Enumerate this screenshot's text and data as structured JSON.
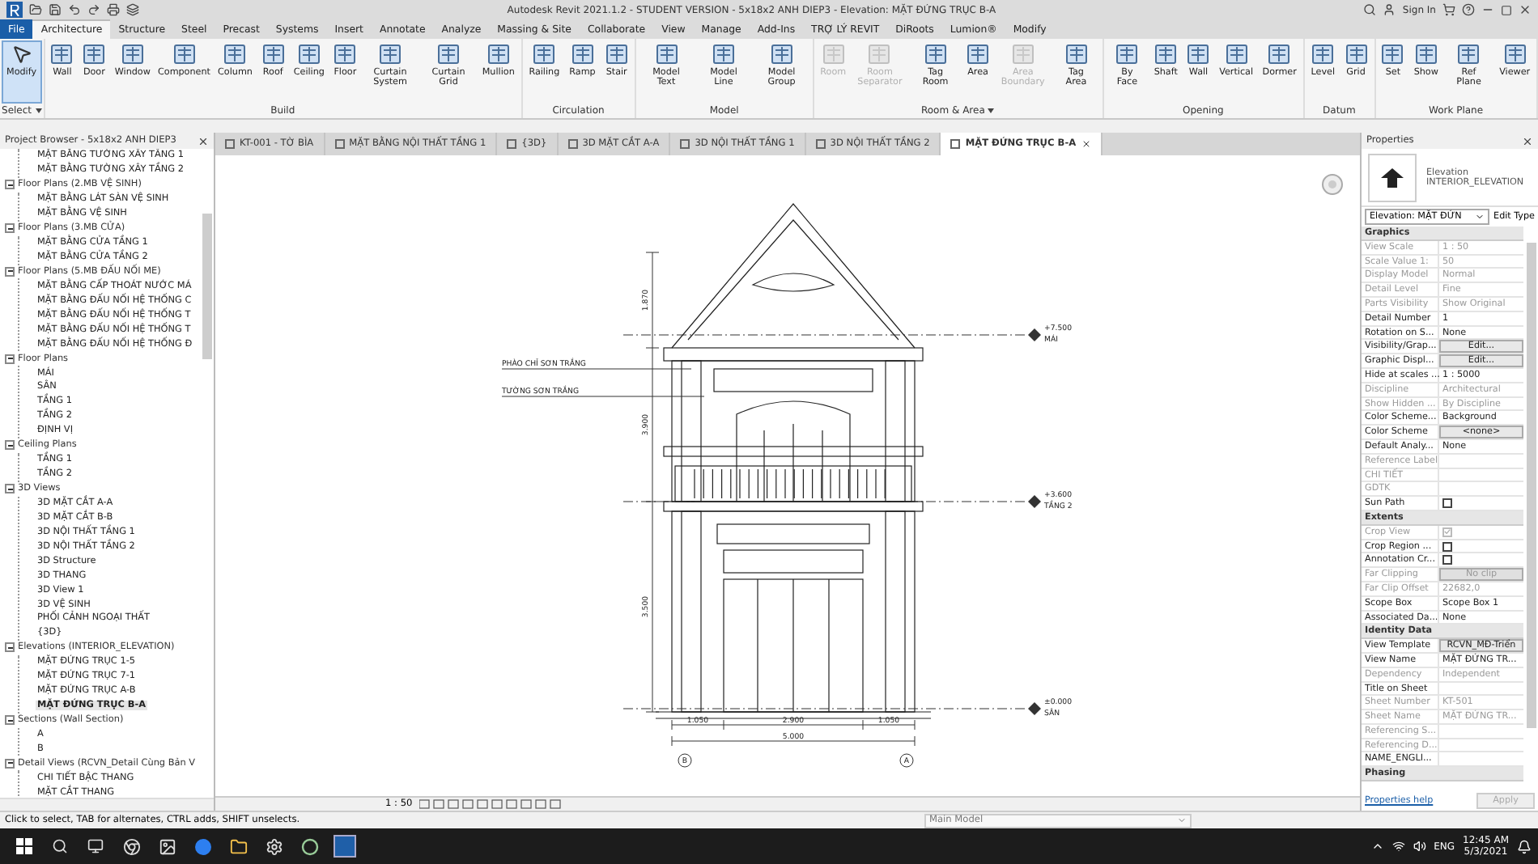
{
  "window": {
    "title": "Autodesk Revit 2021.1.2 - STUDENT VERSION - 5x18x2 ANH DIEP3 - Elevation: MẶT ĐỨNG TRỤC B-A",
    "sign_in": "Sign In"
  },
  "ribbon_tabs": [
    {
      "label": "File",
      "selected": false,
      "kind": "file"
    },
    {
      "label": "Architecture",
      "selected": true,
      "kind": "tab"
    },
    {
      "label": "Structure",
      "selected": false,
      "kind": "tab"
    },
    {
      "label": "Steel",
      "selected": false,
      "kind": "tab"
    },
    {
      "label": "Precast",
      "selected": false,
      "kind": "tab"
    },
    {
      "label": "Systems",
      "selected": false,
      "kind": "tab"
    },
    {
      "label": "Insert",
      "selected": false,
      "kind": "tab"
    },
    {
      "label": "Annotate",
      "selected": false,
      "kind": "tab"
    },
    {
      "label": "Analyze",
      "selected": false,
      "kind": "tab"
    },
    {
      "label": "Massing & Site",
      "selected": false,
      "kind": "tab"
    },
    {
      "label": "Collaborate",
      "selected": false,
      "kind": "tab"
    },
    {
      "label": "View",
      "selected": false,
      "kind": "tab"
    },
    {
      "label": "Manage",
      "selected": false,
      "kind": "tab"
    },
    {
      "label": "Add-Ins",
      "selected": false,
      "kind": "tab"
    },
    {
      "label": "TRỢ LÝ REVIT",
      "selected": false,
      "kind": "tab"
    },
    {
      "label": "DiRoots",
      "selected": false,
      "kind": "tab"
    },
    {
      "label": "Lumion®",
      "selected": false,
      "kind": "tab"
    },
    {
      "label": "Modify",
      "selected": false,
      "kind": "tab"
    }
  ],
  "ribbon_groups": [
    {
      "label": "Select",
      "dropdown": true,
      "tools": [
        {
          "label": "Modify",
          "selected": true,
          "disabled": false
        }
      ]
    },
    {
      "label": "Build",
      "dropdown": false,
      "tools": [
        {
          "label": "Wall",
          "selected": false,
          "disabled": false
        },
        {
          "label": "Door",
          "selected": false,
          "disabled": false
        },
        {
          "label": "Window",
          "selected": false,
          "disabled": false
        },
        {
          "label": "Component",
          "selected": false,
          "disabled": false
        },
        {
          "label": "Column",
          "selected": false,
          "disabled": false
        },
        {
          "label": "Roof",
          "selected": false,
          "disabled": false
        },
        {
          "label": "Ceiling",
          "selected": false,
          "disabled": false
        },
        {
          "label": "Floor",
          "selected": false,
          "disabled": false
        },
        {
          "label": "Curtain System",
          "selected": false,
          "disabled": false
        },
        {
          "label": "Curtain Grid",
          "selected": false,
          "disabled": false
        },
        {
          "label": "Mullion",
          "selected": false,
          "disabled": false
        }
      ]
    },
    {
      "label": "Circulation",
      "dropdown": false,
      "tools": [
        {
          "label": "Railing",
          "selected": false,
          "disabled": false
        },
        {
          "label": "Ramp",
          "selected": false,
          "disabled": false
        },
        {
          "label": "Stair",
          "selected": false,
          "disabled": false
        }
      ]
    },
    {
      "label": "Model",
      "dropdown": false,
      "tools": [
        {
          "label": "Model Text",
          "selected": false,
          "disabled": false
        },
        {
          "label": "Model Line",
          "selected": false,
          "disabled": false
        },
        {
          "label": "Model Group",
          "selected": false,
          "disabled": false
        }
      ]
    },
    {
      "label": "Room & Area",
      "dropdown": true,
      "tools": [
        {
          "label": "Room",
          "selected": false,
          "disabled": true
        },
        {
          "label": "Room Separator",
          "selected": false,
          "disabled": true
        },
        {
          "label": "Tag Room",
          "selected": false,
          "disabled": false
        },
        {
          "label": "Area",
          "selected": false,
          "disabled": false
        },
        {
          "label": "Area Boundary",
          "selected": false,
          "disabled": true
        },
        {
          "label": "Tag Area",
          "selected": false,
          "disabled": false
        }
      ]
    },
    {
      "label": "Opening",
      "dropdown": false,
      "tools": [
        {
          "label": "By Face",
          "selected": false,
          "disabled": false
        },
        {
          "label": "Shaft",
          "selected": false,
          "disabled": false
        },
        {
          "label": "Wall",
          "selected": false,
          "disabled": false
        },
        {
          "label": "Vertical",
          "selected": false,
          "disabled": false
        },
        {
          "label": "Dormer",
          "selected": false,
          "disabled": false
        }
      ]
    },
    {
      "label": "Datum",
      "dropdown": false,
      "tools": [
        {
          "label": "Level",
          "selected": false,
          "disabled": false
        },
        {
          "label": "Grid",
          "selected": false,
          "disabled": false
        }
      ]
    },
    {
      "label": "Work Plane",
      "dropdown": false,
      "tools": [
        {
          "label": "Set",
          "selected": false,
          "disabled": false
        },
        {
          "label": "Show",
          "selected": false,
          "disabled": false
        },
        {
          "label": "Ref Plane",
          "selected": false,
          "disabled": false
        },
        {
          "label": "Viewer",
          "selected": false,
          "disabled": false
        }
      ]
    }
  ],
  "project_browser": {
    "title": "Project Browser - 5x18x2 ANH DIEP3",
    "top_items": [
      {
        "label": "MẶT BẰNG TƯỜNG XÂY TẦNG 1",
        "selected": false
      },
      {
        "label": "MẶT BẰNG TƯỜNG XÂY TẦNG 2",
        "selected": false
      }
    ],
    "tree": [
      {
        "label": "Floor Plans (2.MB VỆ SINH)",
        "expanded": true,
        "children": [
          {
            "label": "MẶT BẰNG LÁT SÀN VỆ SINH",
            "selected": false
          },
          {
            "label": "MẶT BẰNG VỆ SINH",
            "selected": false
          }
        ]
      },
      {
        "label": "Floor Plans (3.MB CỬA)",
        "expanded": true,
        "children": [
          {
            "label": "MẶT BẰNG CỬA TẦNG 1",
            "selected": false
          },
          {
            "label": "MẶT BẰNG CỬA TẦNG 2",
            "selected": false
          }
        ]
      },
      {
        "label": "Floor Plans (5.MB ĐẤU NỐI ME)",
        "expanded": true,
        "children": [
          {
            "label": "MẶT BẰNG CẤP THOÁT NƯỚC MÁ",
            "selected": false
          },
          {
            "label": "MẶT BẰNG ĐẤU NỐI HỆ THỐNG C",
            "selected": false
          },
          {
            "label": "MẶT BẰNG ĐẤU NỐI HỆ THỐNG T",
            "selected": false
          },
          {
            "label": "MẶT BẰNG ĐẤU NỐI HỆ THỐNG T",
            "selected": false
          },
          {
            "label": "MẶT BẰNG ĐẤU NỐI HỆ THỐNG Đ",
            "selected": false
          }
        ]
      },
      {
        "label": "Floor Plans",
        "expanded": true,
        "children": [
          {
            "label": "MÁI",
            "selected": false
          },
          {
            "label": "SÂN",
            "selected": false
          },
          {
            "label": "TẦNG 1",
            "selected": false
          },
          {
            "label": "TẦNG 2",
            "selected": false
          },
          {
            "label": "ĐỊNH VỊ",
            "selected": false
          }
        ]
      },
      {
        "label": "Ceiling Plans",
        "expanded": true,
        "children": [
          {
            "label": "TẦNG 1",
            "selected": false
          },
          {
            "label": "TẦNG 2",
            "selected": false
          }
        ]
      },
      {
        "label": "3D Views",
        "expanded": true,
        "children": [
          {
            "label": "3D MẶT CẮT A-A",
            "selected": false
          },
          {
            "label": "3D MẶT CẮT B-B",
            "selected": false
          },
          {
            "label": "3D NỘI THẤT TẦNG 1",
            "selected": false
          },
          {
            "label": "3D NỘI THẤT TẦNG 2",
            "selected": false
          },
          {
            "label": "3D Structure",
            "selected": false
          },
          {
            "label": "3D THANG",
            "selected": false
          },
          {
            "label": "3D View 1",
            "selected": false
          },
          {
            "label": "3D VỆ SINH",
            "selected": false
          },
          {
            "label": "PHỐI CẢNH NGOẠI THẤT",
            "selected": false
          },
          {
            "label": "{3D}",
            "selected": false
          }
        ]
      },
      {
        "label": "Elevations (INTERIOR_ELEVATION)",
        "expanded": true,
        "children": [
          {
            "label": "MẶT ĐỨNG TRỤC 1-5",
            "selected": false
          },
          {
            "label": "MẶT ĐỨNG TRỤC 7-1",
            "selected": false
          },
          {
            "label": "MẶT ĐỨNG TRỤC A-B",
            "selected": false
          },
          {
            "label": "MẶT ĐỨNG TRỤC B-A",
            "selected": true
          }
        ]
      },
      {
        "label": "Sections (Wall Section)",
        "expanded": true,
        "children": [
          {
            "label": "A",
            "selected": false
          },
          {
            "label": "B",
            "selected": false
          }
        ]
      },
      {
        "label": "Detail Views (RCVN_Detail Cùng Bản V",
        "expanded": true,
        "children": [
          {
            "label": "CHI TIẾT BẬC THANG",
            "selected": false
          },
          {
            "label": "MẶT CẮT THANG",
            "selected": false
          }
        ]
      }
    ]
  },
  "view_tabs": [
    {
      "label": "KT-001 - TỜ BÌA",
      "selected": false
    },
    {
      "label": "MẶT BẰNG NỘI THẤT TẦNG 1",
      "selected": false
    },
    {
      "label": "{3D}",
      "selected": false
    },
    {
      "label": "3D MẶT CẮT A-A",
      "selected": false
    },
    {
      "label": "3D NỘI THẤT TẦNG 1",
      "selected": false
    },
    {
      "label": "3D NỘI THẤT TẦNG 2",
      "selected": false
    },
    {
      "label": "MẶT ĐỨNG TRỤC B-A",
      "selected": true
    }
  ],
  "drawing": {
    "notes": [
      "PHÀO CHỈ SƠN TRẮNG",
      "TƯỜNG SƠN TRẮNG"
    ],
    "levels": [
      {
        "name": "MÁI",
        "elevation": "+7.500"
      },
      {
        "name": "TẦNG 2",
        "elevation": "+3.600"
      },
      {
        "name": "SÂN",
        "elevation": "±0.000"
      }
    ],
    "vertical_dims": [
      "1.870",
      "3.900",
      "3.500"
    ],
    "horizontal_dims": [
      "1.050",
      "2.900",
      "1.050"
    ],
    "total_dim": "5.000",
    "grids": [
      "B",
      "A"
    ]
  },
  "view_bar": {
    "scale": "1 : 50"
  },
  "properties": {
    "title": "Properties",
    "family": "Elevation",
    "type": "INTERIOR_ELEVATION",
    "selector": "Elevation: MẶT ĐỨN",
    "edit_type": "Edit Type",
    "sections": [
      {
        "title": "Graphics",
        "rows": [
          {
            "name": "View Scale",
            "value": "1 : 50",
            "kind": "text",
            "disabled": true
          },
          {
            "name": "Scale Value    1:",
            "value": "50",
            "kind": "text",
            "disabled": true
          },
          {
            "name": "Display Model",
            "value": "Normal",
            "kind": "text",
            "disabled": true
          },
          {
            "name": "Detail Level",
            "value": "Fine",
            "kind": "text",
            "disabled": true
          },
          {
            "name": "Parts Visibility",
            "value": "Show Original",
            "kind": "text",
            "disabled": true
          },
          {
            "name": "Detail Number",
            "value": "1",
            "kind": "text",
            "disabled": false
          },
          {
            "name": "Rotation on S...",
            "value": "None",
            "kind": "text",
            "disabled": false
          },
          {
            "name": "Visibility/Grap...",
            "value": "Edit...",
            "kind": "button",
            "disabled": false
          },
          {
            "name": "Graphic Displ...",
            "value": "Edit...",
            "kind": "button",
            "disabled": false
          },
          {
            "name": "Hide at scales ...",
            "value": "1 : 5000",
            "kind": "text",
            "disabled": false
          },
          {
            "name": "Discipline",
            "value": "Architectural",
            "kind": "text",
            "disabled": true
          },
          {
            "name": "Show Hidden ...",
            "value": "By Discipline",
            "kind": "text",
            "disabled": true
          },
          {
            "name": "Color Scheme...",
            "value": "Background",
            "kind": "text",
            "disabled": false
          },
          {
            "name": "Color Scheme",
            "value": "<none>",
            "kind": "button",
            "disabled": false
          },
          {
            "name": "Default Analy...",
            "value": "None",
            "kind": "text",
            "disabled": false
          },
          {
            "name": "Reference Label",
            "kind": "text",
            "disabled": true
          },
          {
            "name": "CHI TIẾT",
            "kind": "text",
            "disabled": true
          },
          {
            "name": "GDTK",
            "kind": "text",
            "disabled": true
          },
          {
            "name": "Sun Path",
            "kind": "checkbox",
            "checked": false,
            "disabled": false
          }
        ]
      },
      {
        "title": "Extents",
        "rows": [
          {
            "name": "Crop View",
            "kind": "checkbox",
            "checked": true,
            "disabled": true
          },
          {
            "name": "Crop Region ...",
            "kind": "checkbox",
            "checked": false,
            "disabled": false
          },
          {
            "name": "Annotation Cr...",
            "kind": "checkbox",
            "checked": false,
            "disabled": false
          },
          {
            "name": "Far Clipping",
            "value": "No clip",
            "kind": "button",
            "disabled": true
          },
          {
            "name": "Far Clip Offset",
            "value": "22682,0",
            "kind": "text",
            "disabled": true
          },
          {
            "name": "Scope Box",
            "value": "Scope Box 1",
            "kind": "text",
            "disabled": false
          },
          {
            "name": "Associated Da...",
            "value": "None",
            "kind": "text",
            "disabled": false
          }
        ]
      },
      {
        "title": "Identity Data",
        "rows": [
          {
            "name": "View Template",
            "value": "RCVN_MĐ-Triển",
            "kind": "button",
            "disabled": false
          },
          {
            "name": "View Name",
            "value": "MẶT ĐỨNG TR...",
            "kind": "text",
            "disabled": false
          },
          {
            "name": "Dependency",
            "value": "Independent",
            "kind": "text",
            "disabled": true
          },
          {
            "name": "Title on Sheet",
            "kind": "text",
            "disabled": false
          },
          {
            "name": "Sheet Number",
            "value": "KT-501",
            "kind": "text",
            "disabled": true
          },
          {
            "name": "Sheet Name",
            "value": "MẶT ĐỨNG TR...",
            "kind": "text",
            "disabled": true
          },
          {
            "name": "Referencing S...",
            "kind": "text",
            "disabled": true
          },
          {
            "name": "Referencing D...",
            "kind": "text",
            "disabled": true
          },
          {
            "name": "NAME_ENGLI...",
            "kind": "text",
            "disabled": false
          }
        ]
      },
      {
        "title": "Phasing"
      }
    ],
    "help": "Properties help",
    "apply": {
      "label": "Apply",
      "disabled": true
    }
  },
  "status_bar": {
    "hint": "Click to select, TAB for alternates, CTRL adds, SHIFT unselects.",
    "workset": "Main Model"
  },
  "taskbar": {
    "language": "ENG",
    "time": "12:45 AM",
    "date": "5/3/2021"
  }
}
